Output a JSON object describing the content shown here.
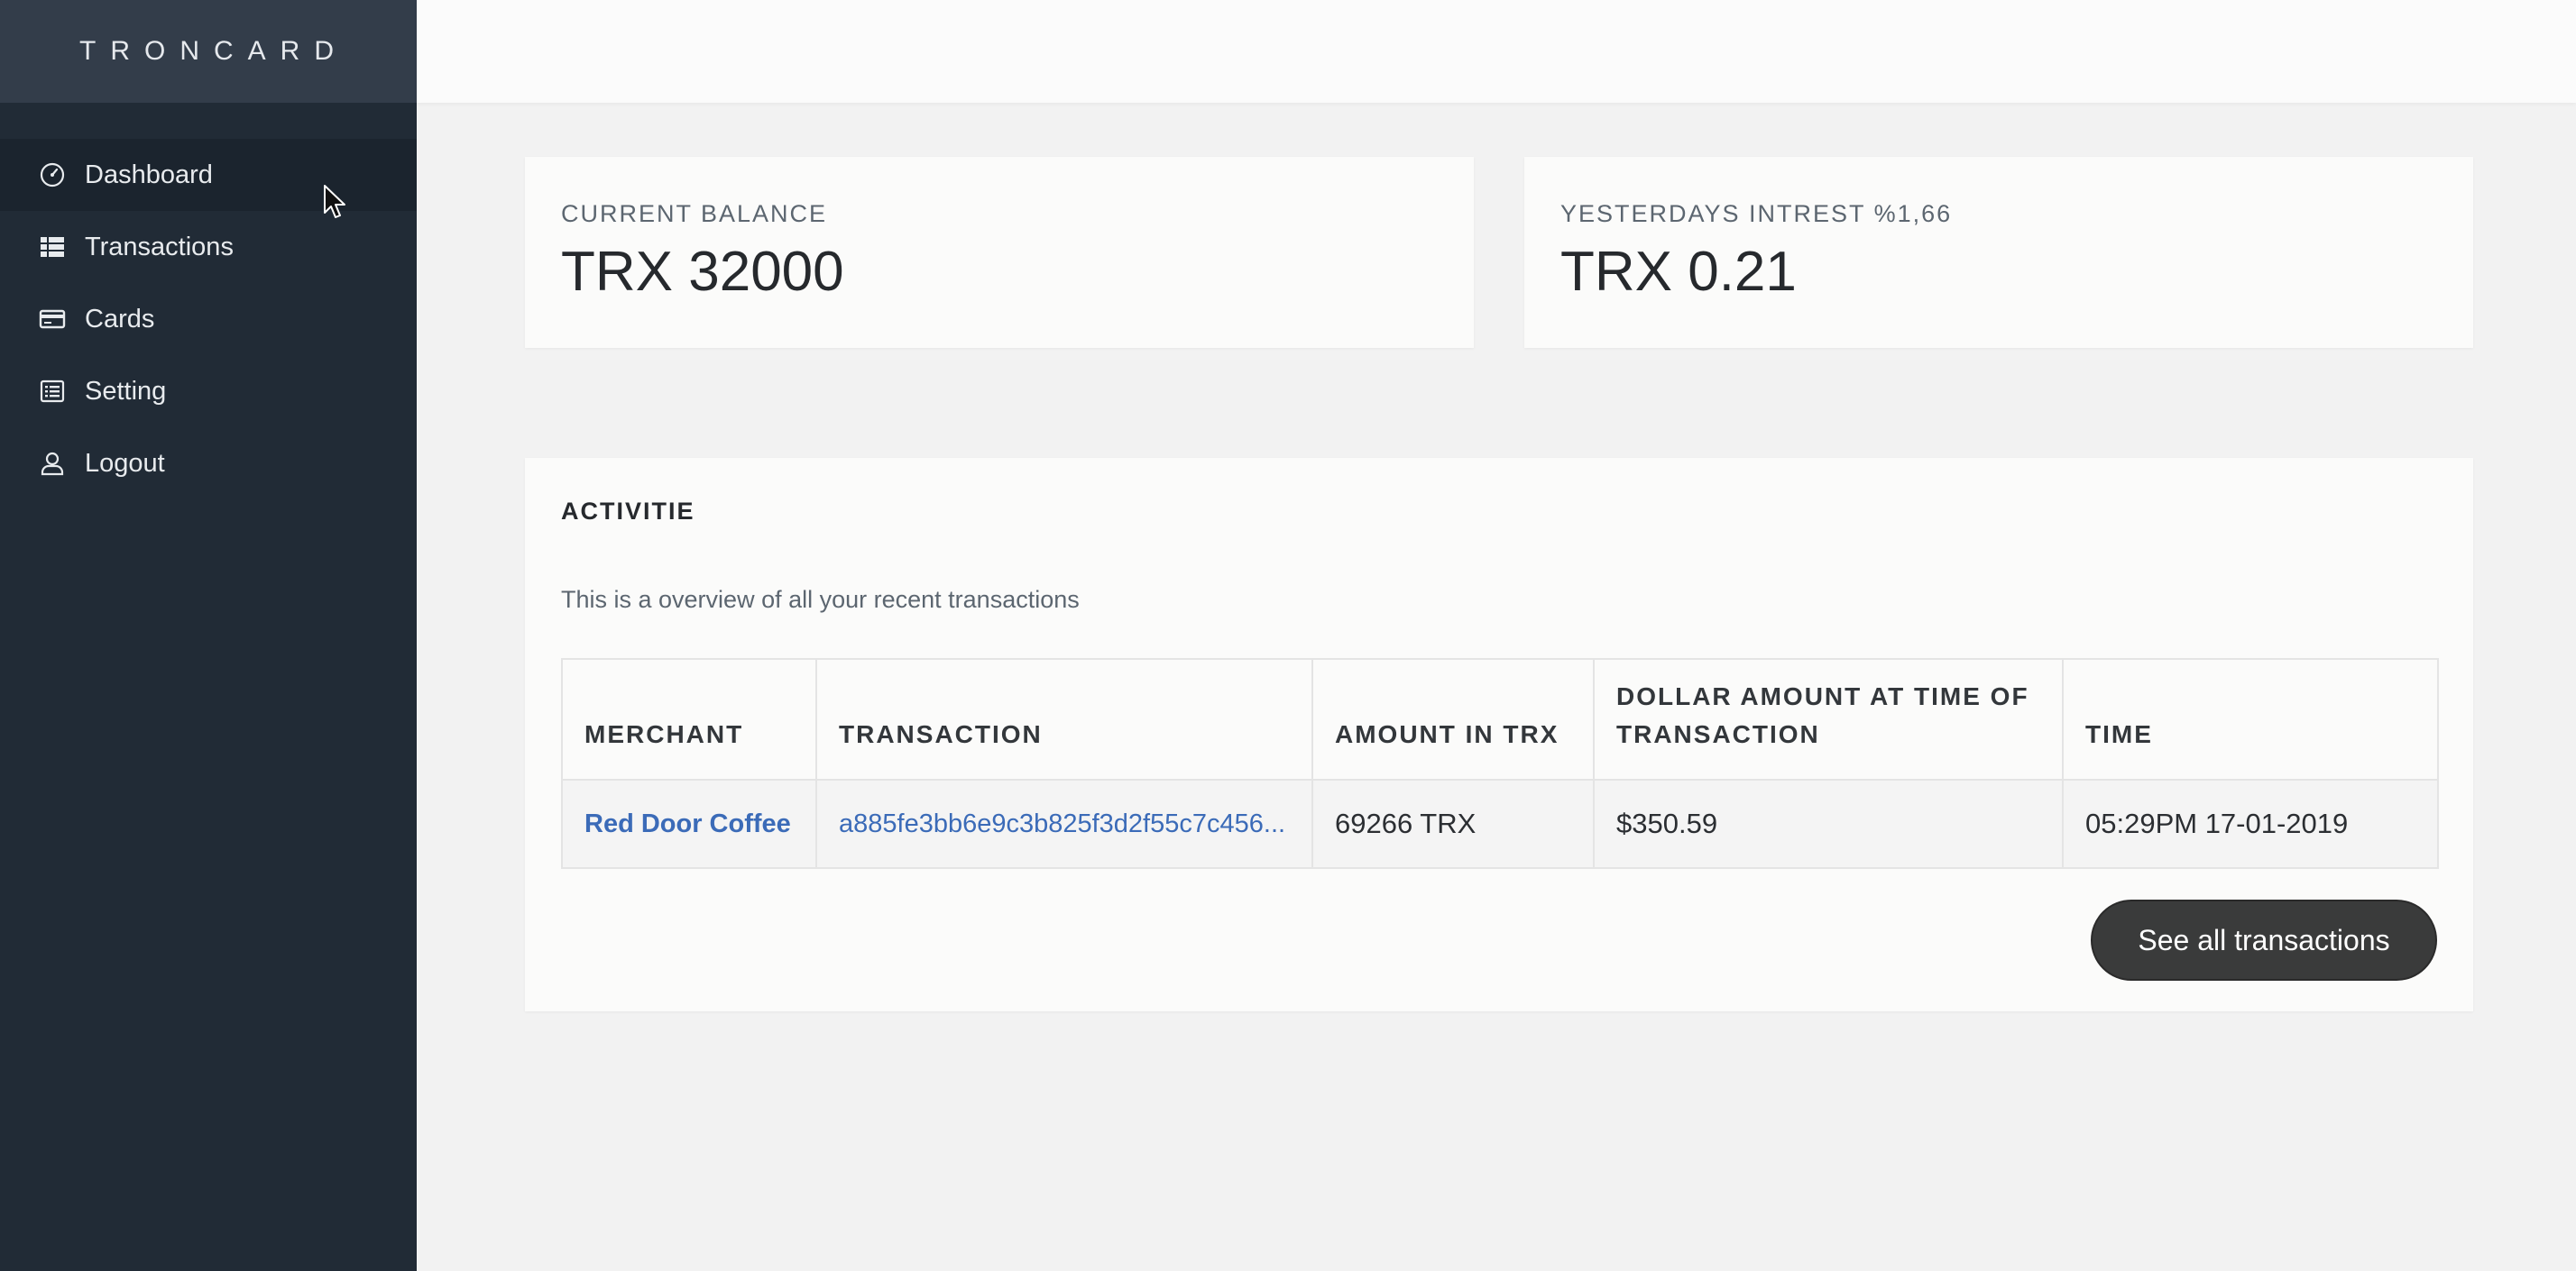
{
  "brand": "TRONCARD",
  "sidebar": {
    "items": [
      {
        "label": "Dashboard",
        "icon": "speedometer-icon"
      },
      {
        "label": "Transactions",
        "icon": "list-icon"
      },
      {
        "label": "Cards",
        "icon": "credit-card-icon"
      },
      {
        "label": "Setting",
        "icon": "settings-list-icon"
      },
      {
        "label": "Logout",
        "icon": "user-icon"
      }
    ],
    "active": "Dashboard"
  },
  "stats": {
    "balance": {
      "label": "CURRENT BALANCE",
      "value": "TRX 32000"
    },
    "interest": {
      "label": "YESTERDAYS INTREST %1,66",
      "value": "TRX 0.21"
    }
  },
  "activity": {
    "title": "ACTIVITIE",
    "description": "This is a overview of all your recent transactions",
    "columns": [
      "MERCHANT",
      "TRANSACTION",
      "AMOUNT IN TRX",
      "DOLLAR AMOUNT AT TIME OF TRANSACTION",
      "TIME"
    ],
    "rows": [
      {
        "merchant": "Red Door Coffee",
        "transaction": "a885fe3bb6e9c3b825f3d2f55c7c456...",
        "amount_trx": "69266 TRX",
        "dollar_amount": "$350.59",
        "time": "05:29PM 17-01-2019"
      }
    ],
    "see_all_label": "See all transactions"
  },
  "colors": {
    "sidebar_bg": "#212b36",
    "brand_bg": "#333d4a",
    "link": "#3b6bb8",
    "button_bg": "#3a3b3b"
  }
}
